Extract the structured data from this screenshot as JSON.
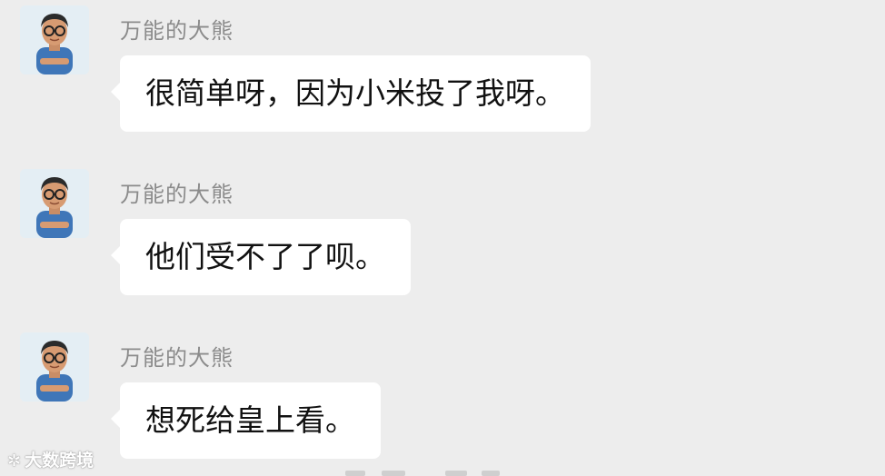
{
  "colors": {
    "background": "#ededed",
    "bubble": "#ffffff",
    "sender_name": "#8b8b8b",
    "message_text": "#111111"
  },
  "messages": [
    {
      "sender": "万能的大熊",
      "avatar_icon": "avatar-icon",
      "text": "很简单呀，因为小米投了我呀。"
    },
    {
      "sender": "万能的大熊",
      "avatar_icon": "avatar-icon",
      "text": "他们受不了了呗。"
    },
    {
      "sender": "万能的大熊",
      "avatar_icon": "avatar-icon",
      "text": "想死给皇上看。"
    }
  ],
  "watermark": {
    "text": "大数跨境"
  }
}
